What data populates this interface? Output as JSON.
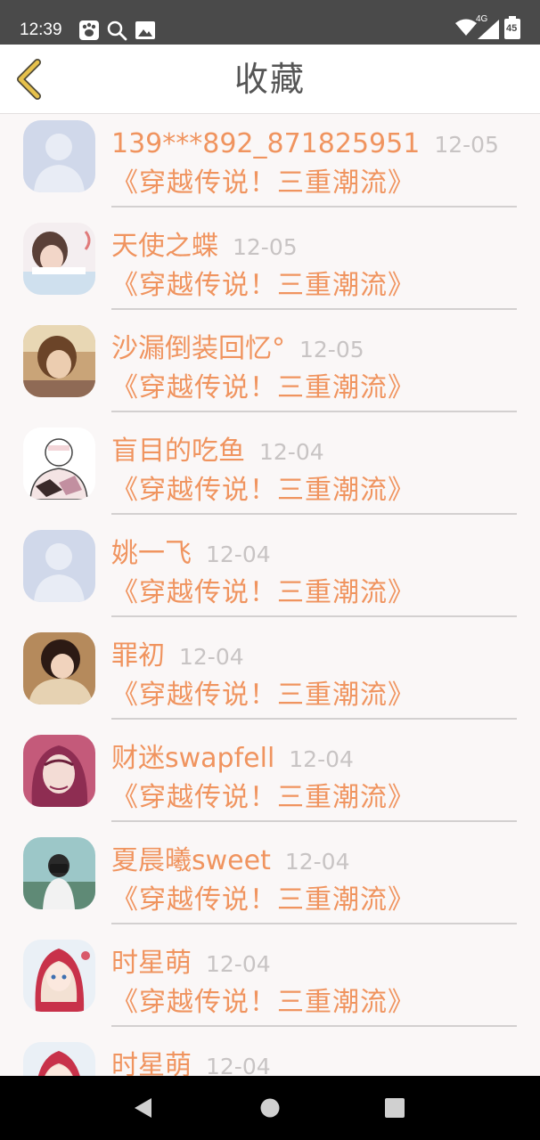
{
  "status_bar": {
    "time": "12:39",
    "network": "4G",
    "battery": "45",
    "icons": [
      "paw-icon",
      "search-icon",
      "image-icon",
      "wifi-icon",
      "signal-icon",
      "battery-icon"
    ]
  },
  "header": {
    "title": "收藏",
    "back_icon": "chevron-left-icon"
  },
  "colors": {
    "accent": "#f0945f",
    "date": "#c8c4c4",
    "background": "#faf7f7",
    "back_arrow": "#e6c14c"
  },
  "items": [
    {
      "name": "139***892_871825951",
      "date": "12-05",
      "book": "《穿越传说！三重潮流》",
      "avatar": "default"
    },
    {
      "name": "天使之蝶",
      "date": "12-05",
      "book": "《穿越传说！三重潮流》",
      "avatar": "photo"
    },
    {
      "name": "沙漏倒装回忆°",
      "date": "12-05",
      "book": "《穿越传说！三重潮流》",
      "avatar": "photo"
    },
    {
      "name": "盲目的吃鱼",
      "date": "12-04",
      "book": "《穿越传说！三重潮流》",
      "avatar": "drawing"
    },
    {
      "name": "姚一飞",
      "date": "12-04",
      "book": "《穿越传说！三重潮流》",
      "avatar": "default"
    },
    {
      "name": "罪初",
      "date": "12-04",
      "book": "《穿越传说！三重潮流》",
      "avatar": "photo"
    },
    {
      "name": "财迷swapfell",
      "date": "12-04",
      "book": "《穿越传说！三重潮流》",
      "avatar": "illustration"
    },
    {
      "name": "夏晨曦sweet",
      "date": "12-04",
      "book": "《穿越传说！三重潮流》",
      "avatar": "photo"
    },
    {
      "name": "时星萌",
      "date": "12-04",
      "book": "《穿越传说！三重潮流》",
      "avatar": "illustration"
    },
    {
      "name": "时星萌",
      "date": "12-04",
      "book": "",
      "avatar": "illustration"
    }
  ],
  "nav_bar": {
    "icons": [
      "back-triangle-icon",
      "home-circle-icon",
      "recents-square-icon"
    ]
  }
}
